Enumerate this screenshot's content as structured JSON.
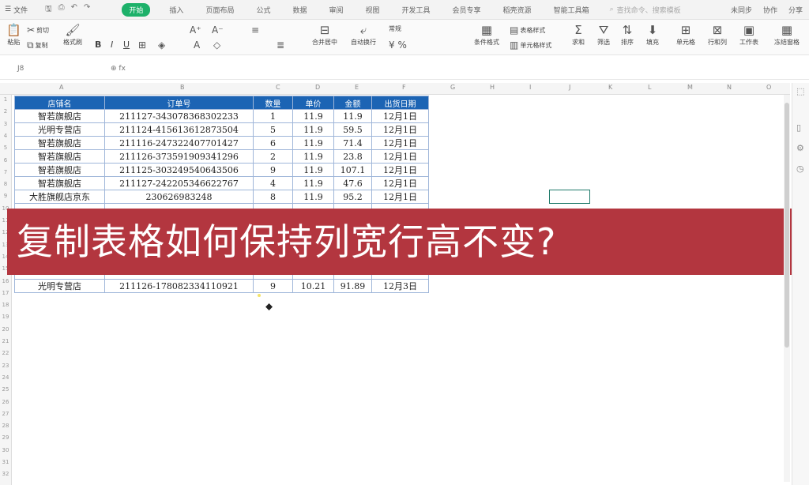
{
  "menubar": {
    "file_label": "文件",
    "tabs": [
      "开始",
      "插入",
      "页面布局",
      "公式",
      "数据",
      "审阅",
      "视图",
      "开发工具",
      "会员专享",
      "稻壳资源",
      "智能工具箱"
    ],
    "active_tab": "开始",
    "search_placeholder": "查找命令、搜索模板",
    "right_items": [
      "未同步",
      "协作",
      "分享"
    ]
  },
  "ribbon": {
    "paste": "粘贴",
    "cut": "剪切",
    "copy": "复制",
    "format_painter": "格式刷",
    "bold": "B",
    "italic": "I",
    "underline": "U",
    "merge": "合并居中",
    "wrap": "自动换行",
    "number_format": "常规",
    "cond_format": "条件格式",
    "table_style": "表格样式",
    "cell_style": "单元格样式",
    "sum": "求和",
    "filter": "筛选",
    "sort": "排序",
    "fill": "填充",
    "cells": "单元格",
    "row_col": "行和列",
    "worksheet": "工作表",
    "freeze": "冻结窗格"
  },
  "formula_bar": {
    "name_box": "J8",
    "fx": "fx"
  },
  "columns": [
    "A",
    "B",
    "C",
    "D",
    "E",
    "F",
    "G",
    "H",
    "I",
    "J",
    "K",
    "L",
    "M",
    "N",
    "O"
  ],
  "rows": [
    "1",
    "2",
    "3",
    "4",
    "5",
    "6",
    "7",
    "8",
    "9",
    "10",
    "11",
    "12",
    "13",
    "14",
    "15",
    "16",
    "17",
    "18",
    "19",
    "20",
    "21",
    "22",
    "23",
    "24",
    "25",
    "26",
    "27",
    "28",
    "29",
    "30",
    "31",
    "32"
  ],
  "table": {
    "headers": [
      "店铺名",
      "订单号",
      "数量",
      "单价",
      "金额",
      "出货日期"
    ],
    "rows": [
      [
        "智若旗舰店",
        "211127-343078368302233",
        "1",
        "11.9",
        "11.9",
        "12月1日"
      ],
      [
        "光明专营店",
        "211124-415613612873504",
        "5",
        "11.9",
        "59.5",
        "12月1日"
      ],
      [
        "智若旗舰店",
        "211116-247322407701427",
        "6",
        "11.9",
        "71.4",
        "12月1日"
      ],
      [
        "智若旗舰店",
        "211126-373591909341296",
        "2",
        "11.9",
        "23.8",
        "12月1日"
      ],
      [
        "智若旗舰店",
        "211125-303249540643506",
        "9",
        "11.9",
        "107.1",
        "12月1日"
      ],
      [
        "智若旗舰店",
        "211127-242205346622767",
        "4",
        "11.9",
        "47.6",
        "12月1日"
      ],
      [
        "大胜旗舰店京东",
        "230626983248",
        "8",
        "11.9",
        "95.2",
        "12月1日"
      ],
      [
        "",
        "",
        "",
        "",
        "",
        ""
      ],
      [
        "",
        "",
        "",
        "",
        "",
        ""
      ],
      [
        "",
        "",
        "",
        "",
        "",
        ""
      ],
      [
        "",
        "",
        "",
        "",
        "",
        ""
      ],
      [
        "",
        "",
        "",
        "",
        "",
        ""
      ],
      [
        "",
        "",
        "",
        "",
        "",
        ""
      ],
      [
        "光明专营店",
        "211126-178082334110921",
        "9",
        "10.21",
        "91.89",
        "12月3日"
      ]
    ]
  },
  "banner_text": "复制表格如何保持列宽行高不变?"
}
